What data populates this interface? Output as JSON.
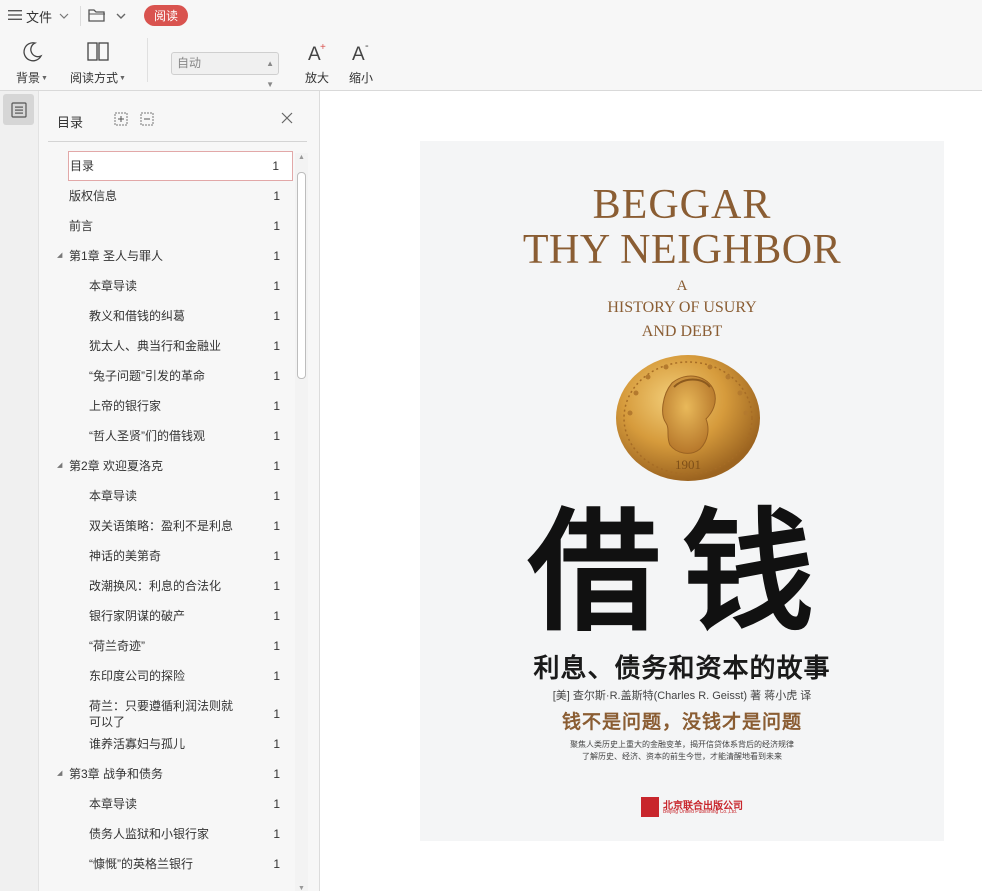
{
  "menu": {
    "file_label": "文件",
    "read_tab": "阅读"
  },
  "toolbar": {
    "background_label": "背景",
    "read_mode_label": "阅读方式",
    "zoom_select_value": "自动",
    "zoom_in_label": "放大",
    "zoom_out_label": "缩小"
  },
  "toc": {
    "title": "目录",
    "items": [
      {
        "title": "目录",
        "page": "1",
        "level": 0,
        "selected": true
      },
      {
        "title": "版权信息",
        "page": "1",
        "level": 0
      },
      {
        "title": "前言",
        "page": "1",
        "level": 0
      },
      {
        "title": "第1章 圣人与罪人",
        "page": "1",
        "level": 0,
        "expanded": true
      },
      {
        "title": "本章导读",
        "page": "1",
        "level": 1
      },
      {
        "title": "教义和借钱的纠葛",
        "page": "1",
        "level": 1
      },
      {
        "title": "犹太人、典当行和金融业",
        "page": "1",
        "level": 1
      },
      {
        "title": "“兔子问题”引发的革命",
        "page": "1",
        "level": 1
      },
      {
        "title": "上帝的银行家",
        "page": "1",
        "level": 1
      },
      {
        "title": "“哲人圣贤”们的借钱观",
        "page": "1",
        "level": 1
      },
      {
        "title": "第2章 欢迎夏洛克",
        "page": "1",
        "level": 0,
        "expanded": true
      },
      {
        "title": "本章导读",
        "page": "1",
        "level": 1
      },
      {
        "title": "双关语策略：盈利不是利息",
        "page": "1",
        "level": 1
      },
      {
        "title": "神话的美第奇",
        "page": "1",
        "level": 1
      },
      {
        "title": "改潮换风：利息的合法化",
        "page": "1",
        "level": 1
      },
      {
        "title": "银行家阴谋的破产",
        "page": "1",
        "level": 1
      },
      {
        "title": "“荷兰奇迹”",
        "page": "1",
        "level": 1
      },
      {
        "title": "东印度公司的探险",
        "page": "1",
        "level": 1
      },
      {
        "title": "荷兰：只要遵循利润法则就",
        "title2": "可以了",
        "page": "1",
        "level": 1
      },
      {
        "title": "谁养活寡妇与孤儿",
        "page": "1",
        "level": 1
      },
      {
        "title": "第3章 战争和债务",
        "page": "1",
        "level": 0,
        "expanded": true
      },
      {
        "title": "本章导读",
        "page": "1",
        "level": 1
      },
      {
        "title": "债务人监狱和小银行家",
        "page": "1",
        "level": 1
      },
      {
        "title": "“慷慨”的英格兰银行",
        "page": "1",
        "level": 1
      }
    ]
  },
  "cover": {
    "en_title_1": "BEGGAR",
    "en_title_2": "THY NEIGHBOR",
    "en_sub_1": "A",
    "en_sub_2": "HISTORY OF USURY",
    "en_sub_3": "AND DEBT",
    "coin_year": "1901",
    "zh_title": "借钱",
    "zh_subtitle": "利息、债务和资本的故事",
    "author_line": "[美] 查尔斯·R.盖斯特(Charles R. Geisst) 著   蒋小虎 译",
    "slogan": "钱不是问题，没钱才是问题",
    "blurb_1": "聚焦人类历史上重大的金融变革，揭开信贷体系背后的经济规律",
    "blurb_2": "了解历史、经济、资本的前生今世，才能清醒地看到未来",
    "publisher": "北京联合出版公司",
    "publisher_en": "Beijing United Publishing Co.,Ltd."
  },
  "colors": {
    "accent_red": "#d9534f",
    "cover_brown": "#8a5d33",
    "publisher_red": "#c8262c"
  }
}
